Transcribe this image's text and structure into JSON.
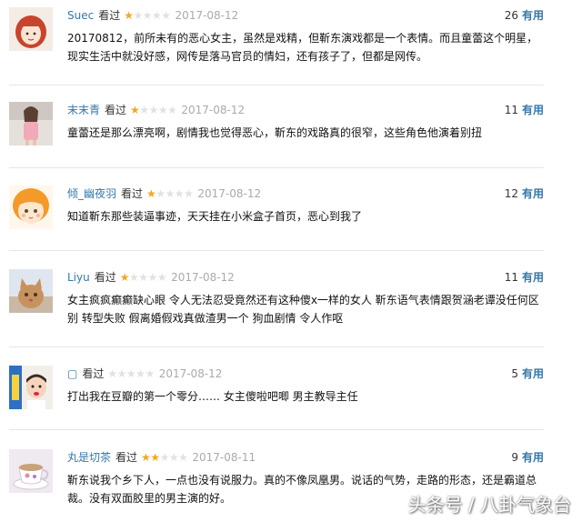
{
  "comments": [
    {
      "user": "Suec",
      "status": "看过",
      "rating": 1,
      "date": "2017-08-12",
      "useful_count": "26",
      "useful_label": "有用",
      "text": "20170812，前所未有的恶心女主，虽然是戏精，但靳东演戏都是一个表情。而且童蕾这个明星，现实生活中就没好感，网传是落马官员的情妇，还有孩子了，但都是网传。",
      "avatar": "red-haired-cartoon-girl"
    },
    {
      "user": "末末青",
      "status": "看过",
      "rating": 1,
      "date": "2017-08-12",
      "useful_count": "11",
      "useful_label": "有用",
      "text": "童蕾还是那么漂亮啊，剧情我也觉得恶心，靳东的戏路真的很窄，这些角色他演着别扭",
      "avatar": "woman-in-pink-photo"
    },
    {
      "user": "倾_幽夜羽",
      "status": "看过",
      "rating": 1,
      "date": "2017-08-12",
      "useful_count": "12",
      "useful_label": "有用",
      "text": "知道靳东那些装逼事迹，天天挂在小米盒子首页，恶心到我了",
      "avatar": "orange-haired-anime-girl"
    },
    {
      "user": "Liyu",
      "status": "看过",
      "rating": 1,
      "date": "2017-08-12",
      "useful_count": "11",
      "useful_label": "有用",
      "text": "女主疯疯癫癫缺心眼 令人无法忍受竟然还有这种傻x一样的女人 靳东语气表情跟贺涵老谭没任何区别 转型失败 假离婚假戏真做渣男一个 狗血剧情 令人作呕",
      "avatar": "cat-photo"
    },
    {
      "user": "▢",
      "status": "看过",
      "rating": 0,
      "date": "2017-08-12",
      "useful_count": "5",
      "useful_label": "有用",
      "text": "打出我在豆瓣的第一个零分…… 女主傻啦吧唧 男主教导主任",
      "avatar": "child-photo"
    },
    {
      "user": "丸是切茶",
      "status": "看过",
      "rating": 2,
      "date": "2017-08-11",
      "useful_count": "9",
      "useful_label": "有用",
      "text": "靳东说我个乡下人，一点也没有说服力。真的不像凤凰男。说话的气势，走路的形态，还是霸道总裁。没有双面胶里的男主演的好。",
      "avatar": "teacup-photo"
    }
  ],
  "watermark": "头条号 / 八卦气象台",
  "colors": {
    "link": "#3377aa",
    "star_on": "#f5a623",
    "star_off": "#e1e1e1",
    "date": "#aaaaaa"
  }
}
